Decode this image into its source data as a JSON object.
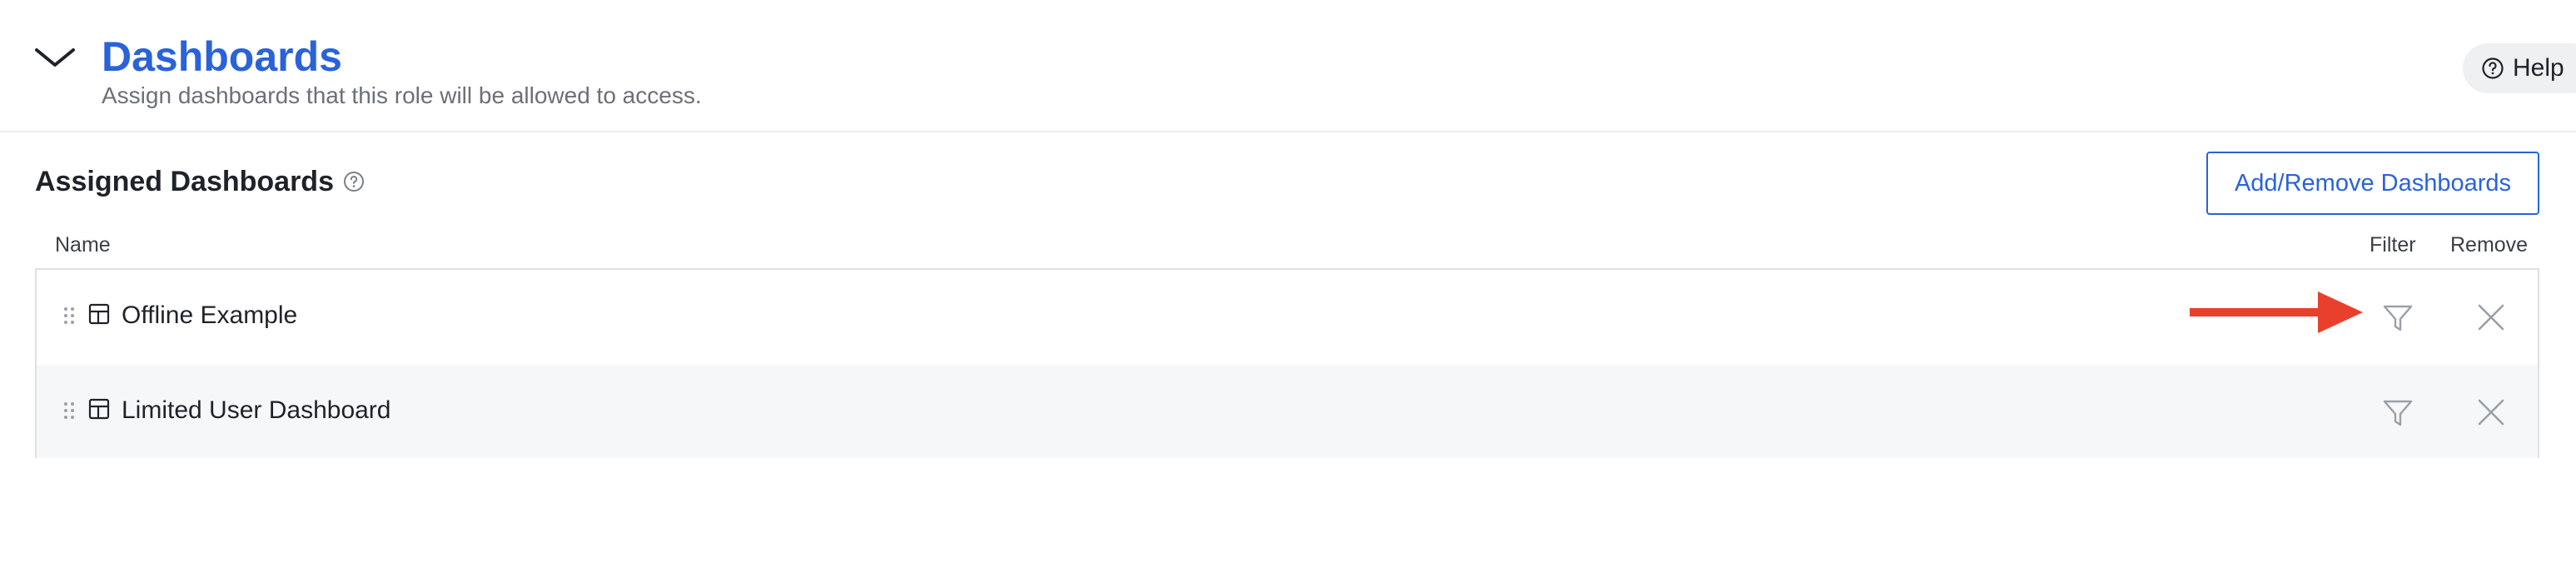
{
  "header": {
    "title": "Dashboards",
    "subtitle": "Assign dashboards that this role will be allowed to access.",
    "help_label": "Help"
  },
  "section": {
    "title": "Assigned Dashboards",
    "add_button_label": "Add/Remove Dashboards"
  },
  "table": {
    "columns": {
      "name": "Name",
      "filter": "Filter",
      "remove": "Remove"
    },
    "rows": [
      {
        "label": "Offline Example"
      },
      {
        "label": "Limited User Dashboard"
      }
    ]
  },
  "icons": {
    "collapse": "chevron-down-icon",
    "help": "question-circle-icon",
    "info": "question-circle-icon",
    "drag": "drag-handle-icon",
    "dashboard": "dashboard-layout-icon",
    "filter": "filter-icon",
    "remove": "close-icon",
    "annotation": "arrow-right-icon"
  },
  "colors": {
    "accent": "#2a63d9",
    "annotation_arrow": "#e8402c",
    "alt_row_bg": "#f6f7f9"
  }
}
